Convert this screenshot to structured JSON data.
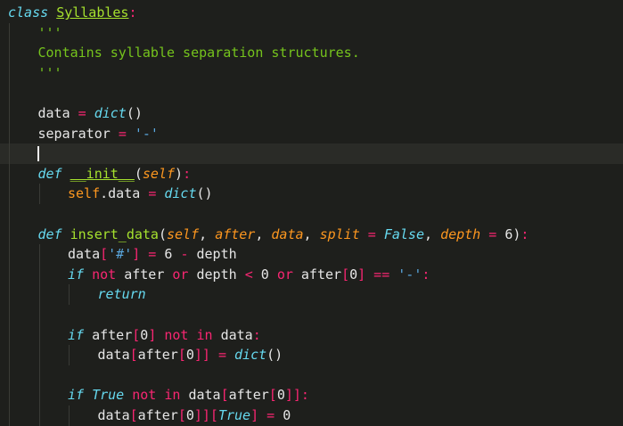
{
  "code": {
    "lines": [
      {
        "tokens": [
          {
            "c": "kw",
            "t": "class "
          },
          {
            "c": "cls",
            "t": "Syllables"
          },
          {
            "c": "op",
            "t": ":"
          }
        ]
      },
      {
        "indent": 1,
        "tokens": [
          {
            "c": "doc",
            "t": "'''"
          }
        ]
      },
      {
        "indent": 1,
        "tokens": [
          {
            "c": "doc",
            "t": "Contains syllable separation structures."
          }
        ]
      },
      {
        "indent": 1,
        "tokens": [
          {
            "c": "doc",
            "t": "'''"
          }
        ]
      },
      {
        "indent": 1,
        "tokens": []
      },
      {
        "indent": 1,
        "tokens": [
          {
            "c": "tx",
            "t": "data "
          },
          {
            "c": "op",
            "t": "= "
          },
          {
            "c": "bi",
            "t": "dict"
          },
          {
            "c": "tx",
            "t": "()"
          }
        ]
      },
      {
        "indent": 1,
        "tokens": [
          {
            "c": "tx",
            "t": "separator "
          },
          {
            "c": "op",
            "t": "= "
          },
          {
            "c": "strb",
            "t": "'-'"
          }
        ]
      },
      {
        "indent": 1,
        "tokens": [],
        "current": true
      },
      {
        "indent": 1,
        "tokens": [
          {
            "c": "kw",
            "t": "def "
          },
          {
            "c": "fnu",
            "t": "__init__"
          },
          {
            "c": "tx",
            "t": "("
          },
          {
            "c": "param",
            "t": "self"
          },
          {
            "c": "tx",
            "t": ")"
          },
          {
            "c": "op",
            "t": ":"
          }
        ]
      },
      {
        "indent": 2,
        "tokens": [
          {
            "c": "self",
            "t": "self"
          },
          {
            "c": "tx",
            "t": ".data "
          },
          {
            "c": "op",
            "t": "= "
          },
          {
            "c": "bi",
            "t": "dict"
          },
          {
            "c": "tx",
            "t": "()"
          }
        ]
      },
      {
        "indent": 1,
        "tokens": []
      },
      {
        "indent": 1,
        "tokens": [
          {
            "c": "kw",
            "t": "def "
          },
          {
            "c": "fn",
            "t": "insert_data"
          },
          {
            "c": "tx",
            "t": "("
          },
          {
            "c": "param",
            "t": "self"
          },
          {
            "c": "tx",
            "t": ", "
          },
          {
            "c": "param",
            "t": "after"
          },
          {
            "c": "tx",
            "t": ", "
          },
          {
            "c": "param",
            "t": "data"
          },
          {
            "c": "tx",
            "t": ", "
          },
          {
            "c": "param",
            "t": "split"
          },
          {
            "c": "op",
            "t": " = "
          },
          {
            "c": "bi",
            "t": "False"
          },
          {
            "c": "tx",
            "t": ", "
          },
          {
            "c": "param",
            "t": "depth"
          },
          {
            "c": "op",
            "t": " = "
          },
          {
            "c": "num2",
            "t": "6"
          },
          {
            "c": "tx",
            "t": ")"
          },
          {
            "c": "op",
            "t": ":"
          }
        ]
      },
      {
        "indent": 2,
        "tokens": [
          {
            "c": "tx",
            "t": "data"
          },
          {
            "c": "br",
            "t": "["
          },
          {
            "c": "strb",
            "t": "'#'"
          },
          {
            "c": "br",
            "t": "]"
          },
          {
            "c": "op",
            "t": " = "
          },
          {
            "c": "tx",
            "t": "6 "
          },
          {
            "c": "op",
            "t": "- "
          },
          {
            "c": "tx",
            "t": "depth"
          }
        ]
      },
      {
        "indent": 2,
        "tokens": [
          {
            "c": "ctl",
            "t": "if "
          },
          {
            "c": "op",
            "t": "not "
          },
          {
            "c": "tx",
            "t": "after "
          },
          {
            "c": "op",
            "t": "or "
          },
          {
            "c": "tx",
            "t": "depth "
          },
          {
            "c": "op",
            "t": "< "
          },
          {
            "c": "tx",
            "t": "0 "
          },
          {
            "c": "op",
            "t": "or "
          },
          {
            "c": "tx",
            "t": "after"
          },
          {
            "c": "br",
            "t": "["
          },
          {
            "c": "tx",
            "t": "0"
          },
          {
            "c": "br",
            "t": "]"
          },
          {
            "c": "op",
            "t": " == "
          },
          {
            "c": "strb",
            "t": "'-'"
          },
          {
            "c": "op",
            "t": ":"
          }
        ]
      },
      {
        "indent": 3,
        "tokens": [
          {
            "c": "ctl",
            "t": "return"
          }
        ]
      },
      {
        "indent": 2,
        "tokens": []
      },
      {
        "indent": 2,
        "tokens": [
          {
            "c": "ctl",
            "t": "if "
          },
          {
            "c": "tx",
            "t": "after"
          },
          {
            "c": "br",
            "t": "["
          },
          {
            "c": "tx",
            "t": "0"
          },
          {
            "c": "br",
            "t": "]"
          },
          {
            "c": "op",
            "t": " not in "
          },
          {
            "c": "tx",
            "t": "data"
          },
          {
            "c": "op",
            "t": ":"
          }
        ]
      },
      {
        "indent": 3,
        "tokens": [
          {
            "c": "tx",
            "t": "data"
          },
          {
            "c": "br",
            "t": "["
          },
          {
            "c": "tx",
            "t": "after"
          },
          {
            "c": "br",
            "t": "["
          },
          {
            "c": "tx",
            "t": "0"
          },
          {
            "c": "br",
            "t": "]]"
          },
          {
            "c": "op",
            "t": " = "
          },
          {
            "c": "bi",
            "t": "dict"
          },
          {
            "c": "tx",
            "t": "()"
          }
        ]
      },
      {
        "indent": 2,
        "tokens": []
      },
      {
        "indent": 2,
        "tokens": [
          {
            "c": "ctl",
            "t": "if "
          },
          {
            "c": "bi",
            "t": "True"
          },
          {
            "c": "op",
            "t": " not in "
          },
          {
            "c": "tx",
            "t": "data"
          },
          {
            "c": "br",
            "t": "["
          },
          {
            "c": "tx",
            "t": "after"
          },
          {
            "c": "br",
            "t": "["
          },
          {
            "c": "tx",
            "t": "0"
          },
          {
            "c": "br",
            "t": "]]"
          },
          {
            "c": "op",
            "t": ":"
          }
        ]
      },
      {
        "indent": 3,
        "tokens": [
          {
            "c": "tx",
            "t": "data"
          },
          {
            "c": "br",
            "t": "["
          },
          {
            "c": "tx",
            "t": "after"
          },
          {
            "c": "br",
            "t": "["
          },
          {
            "c": "tx",
            "t": "0"
          },
          {
            "c": "br",
            "t": "]]["
          },
          {
            "c": "bi",
            "t": "True"
          },
          {
            "c": "br",
            "t": "]"
          },
          {
            "c": "op",
            "t": " = "
          },
          {
            "c": "tx",
            "t": "0"
          }
        ]
      }
    ]
  }
}
